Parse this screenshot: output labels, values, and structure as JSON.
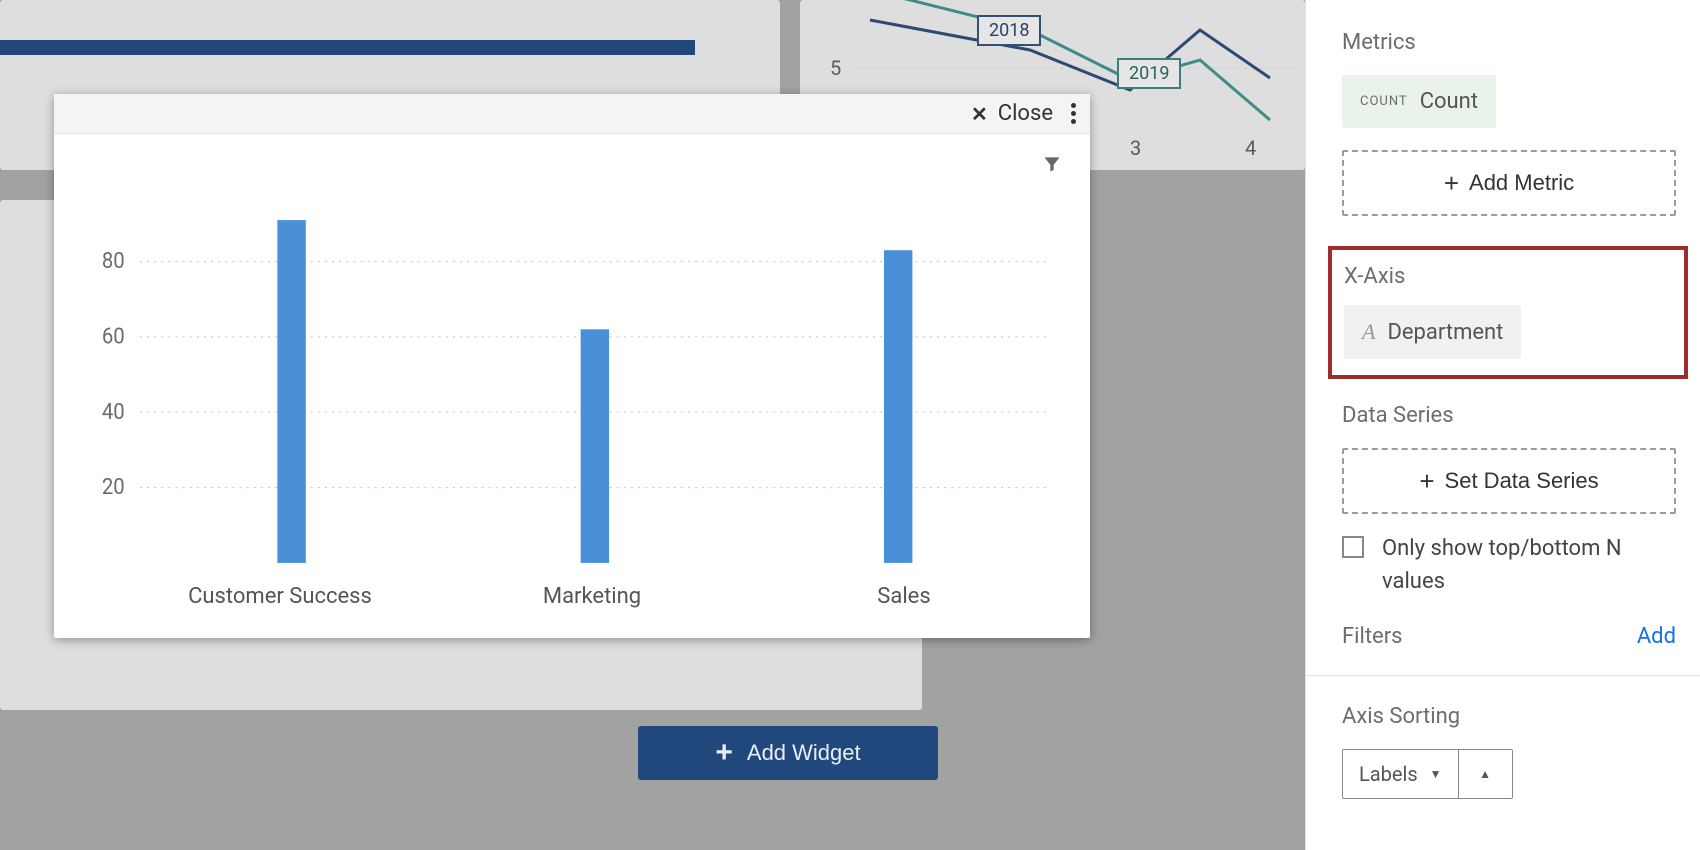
{
  "chart_data": {
    "type": "bar",
    "categories": [
      "Customer Success",
      "Marketing",
      "Sales"
    ],
    "values": [
      91,
      62,
      83
    ],
    "title": "",
    "xlabel": "",
    "ylabel": "",
    "ylim": [
      0,
      100
    ],
    "yticks": [
      20,
      40,
      60,
      80
    ]
  },
  "popup": {
    "close_label": "Close"
  },
  "bg": {
    "line_y_tick": "5",
    "line_x_ticks": {
      "a": "3",
      "b": "4"
    },
    "year_labels": {
      "a": "2018",
      "b": "2019"
    },
    "add_widget_label": "Add Widget"
  },
  "panel": {
    "metrics": {
      "title": "Metrics",
      "count_prefix": "COUNT",
      "count_label": "Count",
      "add_metric_label": "Add Metric"
    },
    "xaxis": {
      "title": "X-Axis",
      "chip": "Department"
    },
    "data_series": {
      "title": "Data Series",
      "button": "Set Data Series",
      "checkbox_label": "Only show top/bottom N values"
    },
    "filters": {
      "title": "Filters",
      "add_label": "Add"
    },
    "axis_sorting": {
      "title": "Axis Sorting",
      "select": "Labels"
    }
  }
}
